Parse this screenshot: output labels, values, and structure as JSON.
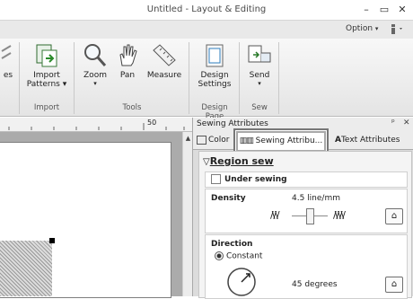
{
  "window": {
    "title": "Untitled - Layout & Editing"
  },
  "option_bar": {
    "label": "Option"
  },
  "ribbon": {
    "partial_label": "es",
    "buttons": {
      "import_patterns": "Import\nPatterns",
      "zoom": "Zoom",
      "pan": "Pan",
      "measure": "Measure",
      "design_settings": "Design\nSettings",
      "send": "Send"
    },
    "groups": {
      "import": "Import",
      "tools": "Tools",
      "design_page": "Design Page",
      "sew": "Sew"
    }
  },
  "ruler": {
    "mark": "50"
  },
  "panel": {
    "title": "Sewing Attributes",
    "tabs": {
      "color": "Color",
      "sewing": "Sewing Attribu...",
      "text": "Text Attributes"
    },
    "region_heading": "Region sew",
    "under_sewing_label": "Under sewing",
    "density_label": "Density",
    "density_value": "4.5 line/mm",
    "direction_label": "Direction",
    "constant_label": "Constant",
    "degrees_value": "45 degrees"
  },
  "colors": {
    "accent_highlight": "#777777",
    "panel_bg": "#dcdcdc"
  }
}
